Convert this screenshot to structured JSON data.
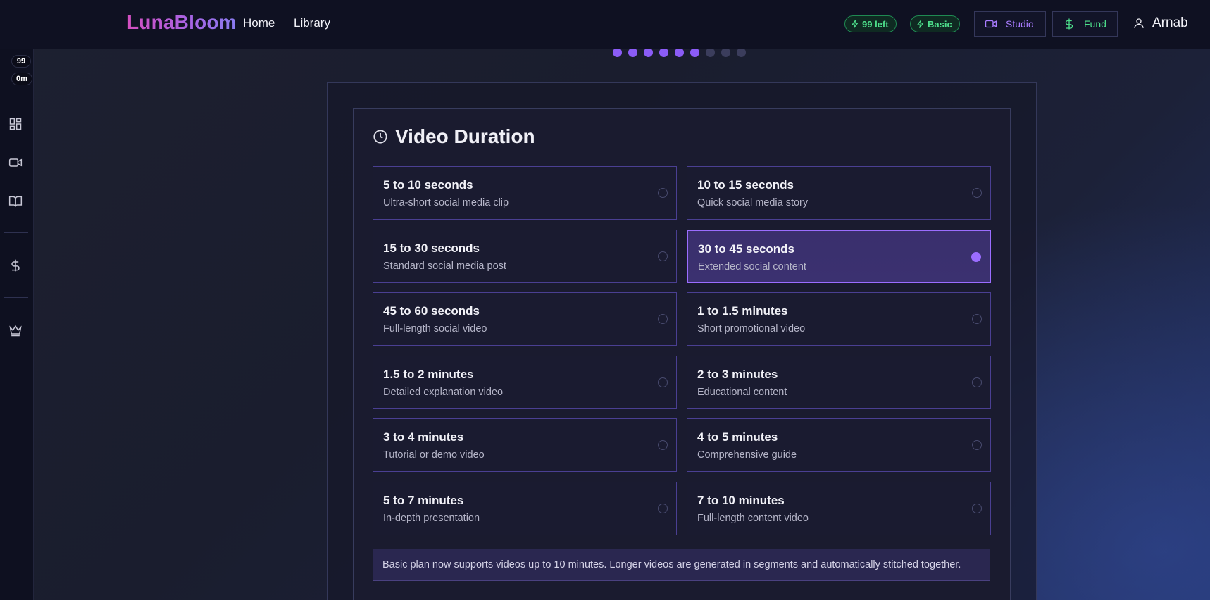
{
  "app": {
    "name": "LunaBloom",
    "nav": [
      {
        "label": "Home"
      },
      {
        "label": "Library"
      }
    ],
    "credits_pill": "99 left",
    "plan_pill": "Basic",
    "studio_label": "Studio",
    "fund_label": "Fund",
    "user_name": "Arnab"
  },
  "rail": {
    "credits": "99",
    "minutes": "0m",
    "icons": [
      "dashboard-icon",
      "video-icon",
      "book-icon",
      "dollar-icon",
      "crown-icon"
    ]
  },
  "progress": {
    "total_steps": 9,
    "completed_steps": 6
  },
  "section": {
    "title": "Video Duration",
    "selected_index": 3,
    "options": [
      {
        "title": "5 to 10 seconds",
        "desc": "Ultra-short social media clip"
      },
      {
        "title": "10 to 15 seconds",
        "desc": "Quick social media story"
      },
      {
        "title": "15 to 30 seconds",
        "desc": "Standard social media post"
      },
      {
        "title": "30 to 45 seconds",
        "desc": "Extended social content"
      },
      {
        "title": "45 to 60 seconds",
        "desc": "Full-length social video"
      },
      {
        "title": "1 to 1.5 minutes",
        "desc": "Short promotional video"
      },
      {
        "title": "1.5 to 2 minutes",
        "desc": "Detailed explanation video"
      },
      {
        "title": "2 to 3 minutes",
        "desc": "Educational content"
      },
      {
        "title": "3 to 4 minutes",
        "desc": "Tutorial or demo video"
      },
      {
        "title": "4 to 5 minutes",
        "desc": "Comprehensive guide"
      },
      {
        "title": "5 to 7 minutes",
        "desc": "In-depth presentation"
      },
      {
        "title": "7 to 10 minutes",
        "desc": "Full-length content video"
      }
    ],
    "notice": "Basic plan now supports videos up to 10 minutes. Longer videos are generated in segments and automatically stitched together."
  },
  "colors": {
    "accent": "#8b5cf6",
    "success": "#4ee08c",
    "brand_gradient_start": "#d44fc0",
    "brand_gradient_end": "#8a7cf0"
  }
}
